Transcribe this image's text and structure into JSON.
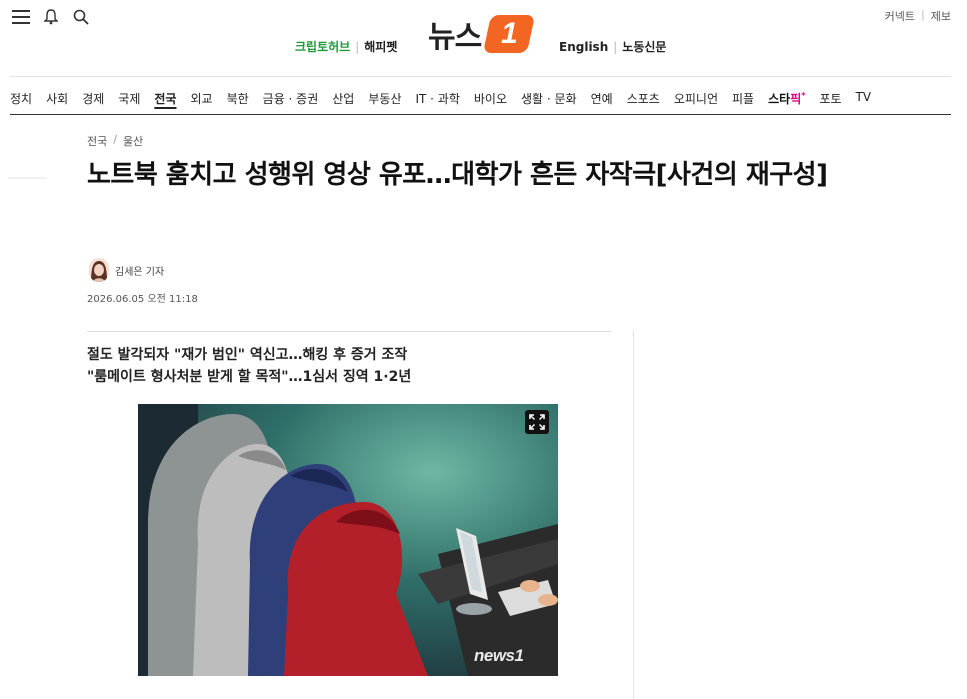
{
  "header": {
    "logo_text": "뉴스",
    "logo_mark": "1",
    "sub_left": [
      "크립토허브",
      "해피펫"
    ],
    "sub_right": [
      "English",
      "노동신문"
    ],
    "top_right": [
      "커넥트",
      "제보"
    ],
    "icons": [
      "menu-icon",
      "bell-icon",
      "search-icon"
    ]
  },
  "nav": {
    "items": [
      "정치",
      "사회",
      "경제",
      "국제",
      "전국",
      "외교",
      "북한",
      "금융 · 증권",
      "산업",
      "부동산",
      "IT · 과학",
      "바이오",
      "생활 · 문화",
      "연예",
      "스포츠",
      "오피니언",
      "피플",
      "포토",
      "TV"
    ],
    "active": "전국",
    "star_label_a": "스타",
    "star_label_b": "픽",
    "star_mark": "*"
  },
  "article": {
    "breadcrumb": [
      "전국",
      "울산"
    ],
    "title": "노트북 훔치고 성행위 영상 유포…대학가 흔든 자작극[사건의 재구성]",
    "author": "김세은 기자",
    "date": "2026.06.05 오전 11:18",
    "subheads": [
      "절도 발각되자 \"재가 범인\" 역신고…해킹 후 증거 조작",
      "\"룸메이트 형사처분 받게 할 목적\"…1심서 징역 1·2년"
    ],
    "photo_watermark": "news1"
  },
  "colors": {
    "accent": "#f26522",
    "green": "#1e9a3a",
    "pink": "#e4007f"
  }
}
